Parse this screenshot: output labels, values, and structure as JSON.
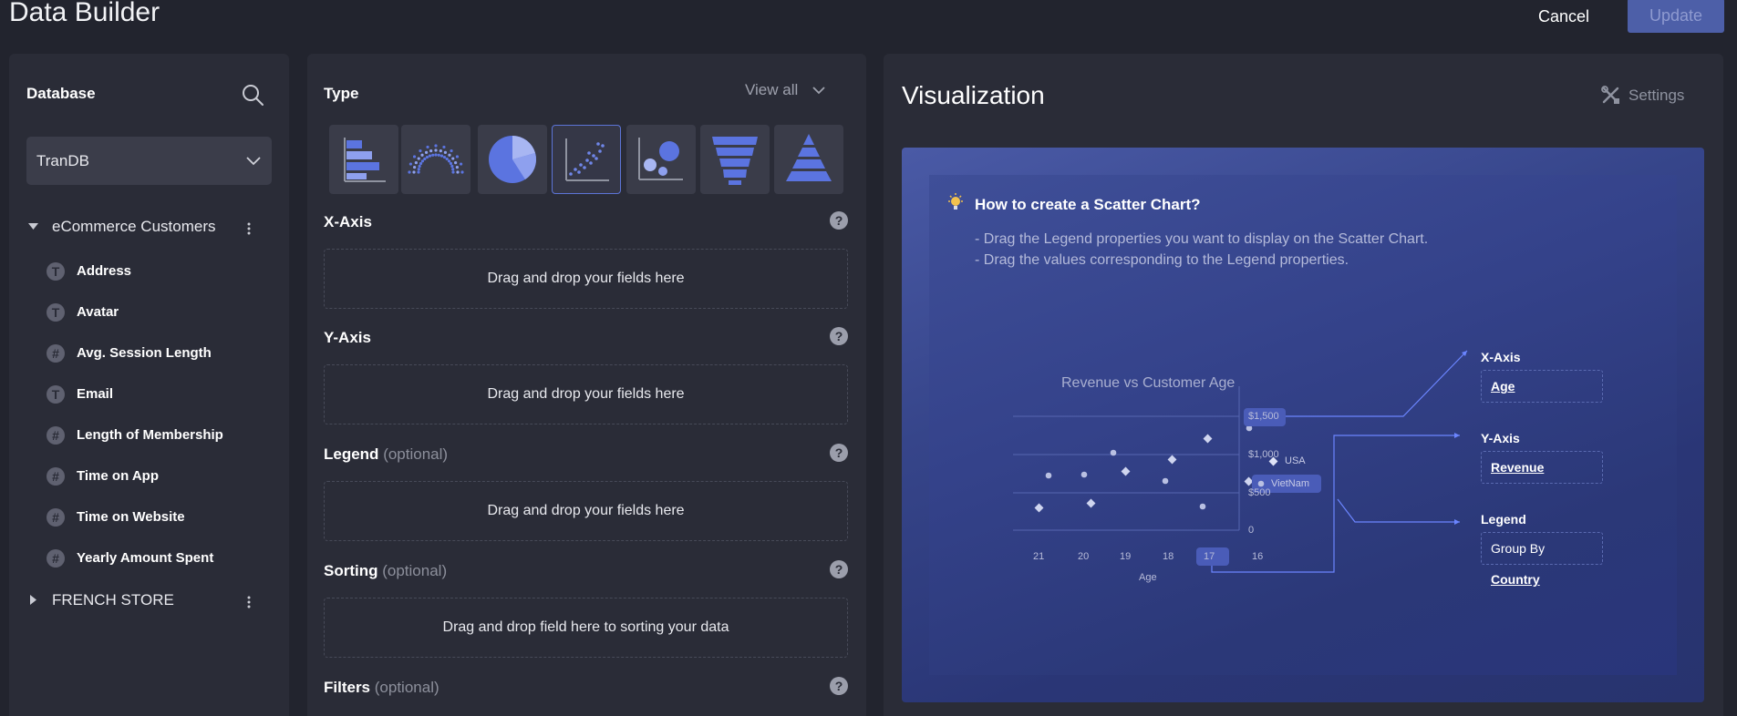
{
  "header": {
    "title": "Data Builder",
    "cancel_label": "Cancel",
    "update_label": "Update"
  },
  "database": {
    "title": "Database",
    "selected_db": "TranDB",
    "groups": [
      {
        "name": "eCommerce Customers",
        "expanded": true,
        "fields": [
          {
            "type": "T",
            "label": "Address"
          },
          {
            "type": "T",
            "label": "Avatar"
          },
          {
            "type": "#",
            "label": "Avg. Session Length"
          },
          {
            "type": "T",
            "label": "Email"
          },
          {
            "type": "#",
            "label": "Length of Membership"
          },
          {
            "type": "#",
            "label": "Time on App"
          },
          {
            "type": "#",
            "label": "Time on Website"
          },
          {
            "type": "#",
            "label": "Yearly Amount Spent"
          }
        ]
      },
      {
        "name": "FRENCH STORE",
        "expanded": false,
        "fields": []
      }
    ]
  },
  "config": {
    "type_label": "Type",
    "view_all_label": "View all",
    "chart_types": [
      {
        "icon": "bar-chart-icon",
        "active": false
      },
      {
        "icon": "parliament-chart-icon",
        "active": false
      },
      {
        "icon": "pie-chart-icon",
        "active": false
      },
      {
        "icon": "scatter-chart-icon",
        "active": true
      },
      {
        "icon": "bubble-chart-icon",
        "active": false
      },
      {
        "icon": "funnel-chart-icon",
        "active": false
      },
      {
        "icon": "pyramid-chart-icon",
        "active": false
      }
    ],
    "sections": [
      {
        "title": "X-Axis",
        "optional": "",
        "placeholder": "Drag and drop your fields here"
      },
      {
        "title": "Y-Axis",
        "optional": "",
        "placeholder": "Drag and drop your fields here"
      },
      {
        "title": "Legend",
        "optional": "(optional)",
        "placeholder": "Drag and drop your fields here"
      },
      {
        "title": "Sorting",
        "optional": "(optional)",
        "placeholder": "Drag and drop field here to sorting your data"
      },
      {
        "title": "Filters",
        "optional": "(optional)",
        "placeholder": ""
      }
    ],
    "help_glyph": "?"
  },
  "visualization": {
    "title": "Visualization",
    "settings_label": "Settings",
    "guide": {
      "title": "How to create a Scatter Chart?",
      "lines": [
        "- Drag the Legend properties you want to display on the Scatter Chart.",
        "- Drag the values corresponding to the Legend properties."
      ],
      "demo": {
        "title": "Revenue vs Customer Age",
        "x_ticks": [
          "21",
          "20",
          "19",
          "18",
          "17",
          "16"
        ],
        "y_ticks": [
          "$1,500",
          "$1,000",
          "$500",
          "0"
        ],
        "x_axis_label": "Age",
        "legend": [
          "USA",
          "VietNam"
        ],
        "mappings": [
          {
            "title": "X-Axis",
            "prefix": "",
            "value": "Age"
          },
          {
            "title": "Y-Axis",
            "prefix": "",
            "value": "Revenue"
          },
          {
            "title": "Legend",
            "prefix": "Group By ",
            "value": "Country"
          }
        ]
      }
    }
  },
  "colors": {
    "accent": "#5c74d6",
    "panel": "#2a2c37",
    "background": "#22242e",
    "update_button": "#4d5fa8"
  }
}
